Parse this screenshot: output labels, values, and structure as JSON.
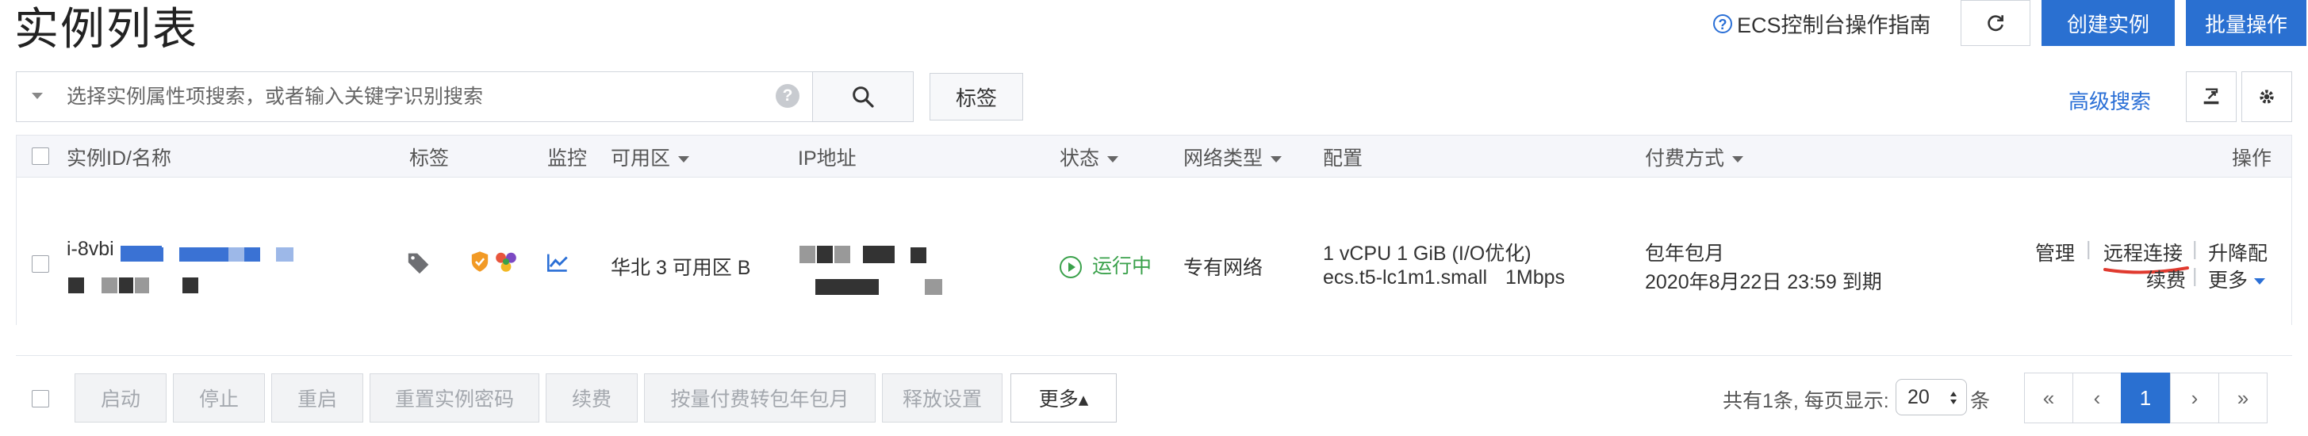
{
  "page_title": "实例列表",
  "header": {
    "guide_label": "ECS控制台操作指南",
    "create_label": "创建实例",
    "batch_label": "批量操作"
  },
  "search": {
    "placeholder": "选择实例属性项搜索，或者输入关键字识别搜索",
    "help_glyph": "?",
    "tag_label": "标签",
    "advanced_label": "高级搜索"
  },
  "table": {
    "columns": [
      "实例ID/名称",
      "标签",
      "监控",
      "可用区",
      "IP地址",
      "状态",
      "网络类型",
      "配置",
      "付费方式",
      "操作"
    ],
    "rows": [
      {
        "id_prefix": "i-8vbi",
        "zone": "华北 3 可用区 B",
        "status": "运行中",
        "network": "专有网络",
        "spec": "1 vCPU 1 GiB (I/O优化)",
        "instance_type": "ecs.t5-lc1m1.small",
        "bandwidth": "1Mbps",
        "pay_type": "包年包月",
        "expire": "2020年8月22日 23:59 到期",
        "actions": {
          "manage": "管理",
          "remote": "远程连接",
          "upgrade": "升降配",
          "renew": "续费",
          "more": "更多"
        }
      }
    ]
  },
  "toolbar": {
    "buttons": [
      "启动",
      "停止",
      "重启",
      "重置实例密码",
      "续费",
      "按量付费转包年包月",
      "释放设置"
    ],
    "more_label": "更多▴"
  },
  "pagination": {
    "info": "共有1条, 每页显示:",
    "page_size": "20",
    "unit": "条",
    "first": "«",
    "prev": "‹",
    "current": "1",
    "next": "›",
    "last": "»"
  },
  "colors": {
    "primary": "#2a70d1",
    "link": "#2a6fd6",
    "running": "#3aa14b",
    "underline_annotation": "#e03a2f"
  }
}
